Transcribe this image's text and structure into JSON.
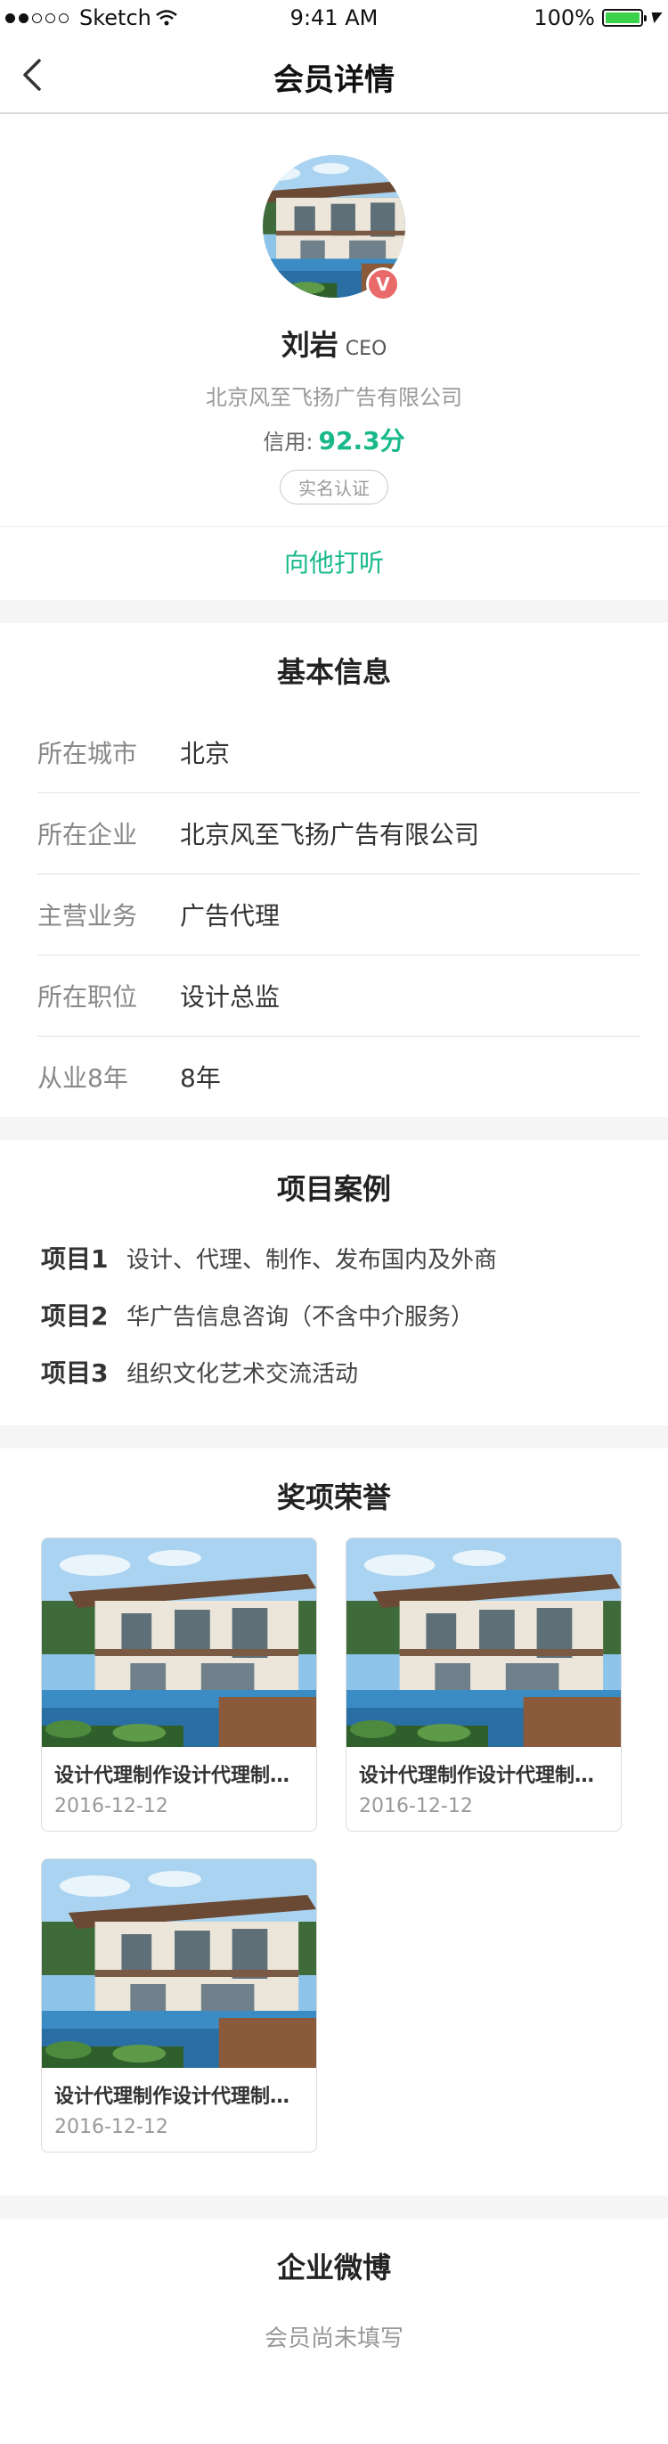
{
  "status_bar": {
    "carrier": "Sketch",
    "time": "9:41 AM",
    "battery": "100%"
  },
  "nav": {
    "title": "会员详情"
  },
  "profile": {
    "name": "刘岩",
    "title": "CEO",
    "company": "北京风至飞扬广告有限公司",
    "credit_label": "信用:",
    "credit_score": "92.3分",
    "verify_badge": "实名认证",
    "verified_mark": "V",
    "inquire_label": "向他打听"
  },
  "basic": {
    "title": "基本信息",
    "rows": [
      {
        "label": "所在城市",
        "value": "北京"
      },
      {
        "label": "所在企业",
        "value": "北京风至飞扬广告有限公司"
      },
      {
        "label": "主营业务",
        "value": "广告代理"
      },
      {
        "label": "所在职位",
        "value": "设计总监"
      },
      {
        "label": "从业8年",
        "value": "8年"
      }
    ]
  },
  "projects": {
    "title": "项目案例",
    "items": [
      {
        "label": "项目1",
        "text": "设计、代理、制作、发布国内及外商"
      },
      {
        "label": "项目2",
        "text": "华广告信息咨询（不含中介服务）"
      },
      {
        "label": "项目3",
        "text": "组织文化艺术交流活动"
      }
    ]
  },
  "awards": {
    "title": "奖项荣誉",
    "items": [
      {
        "caption": "设计代理制作设计代理制作设计代理制作",
        "date": "2016-12-12"
      },
      {
        "caption": "设计代理制作设计代理制作设计代理制作",
        "date": "2016-12-12"
      },
      {
        "caption": "设计代理制作设计代理制作设计代理制作",
        "date": "2016-12-12"
      }
    ]
  },
  "weibo": {
    "title": "企业微博",
    "empty_text": "会员尚未填写"
  },
  "colors": {
    "accent": "#19b98b",
    "badge": "#e96a6a"
  }
}
